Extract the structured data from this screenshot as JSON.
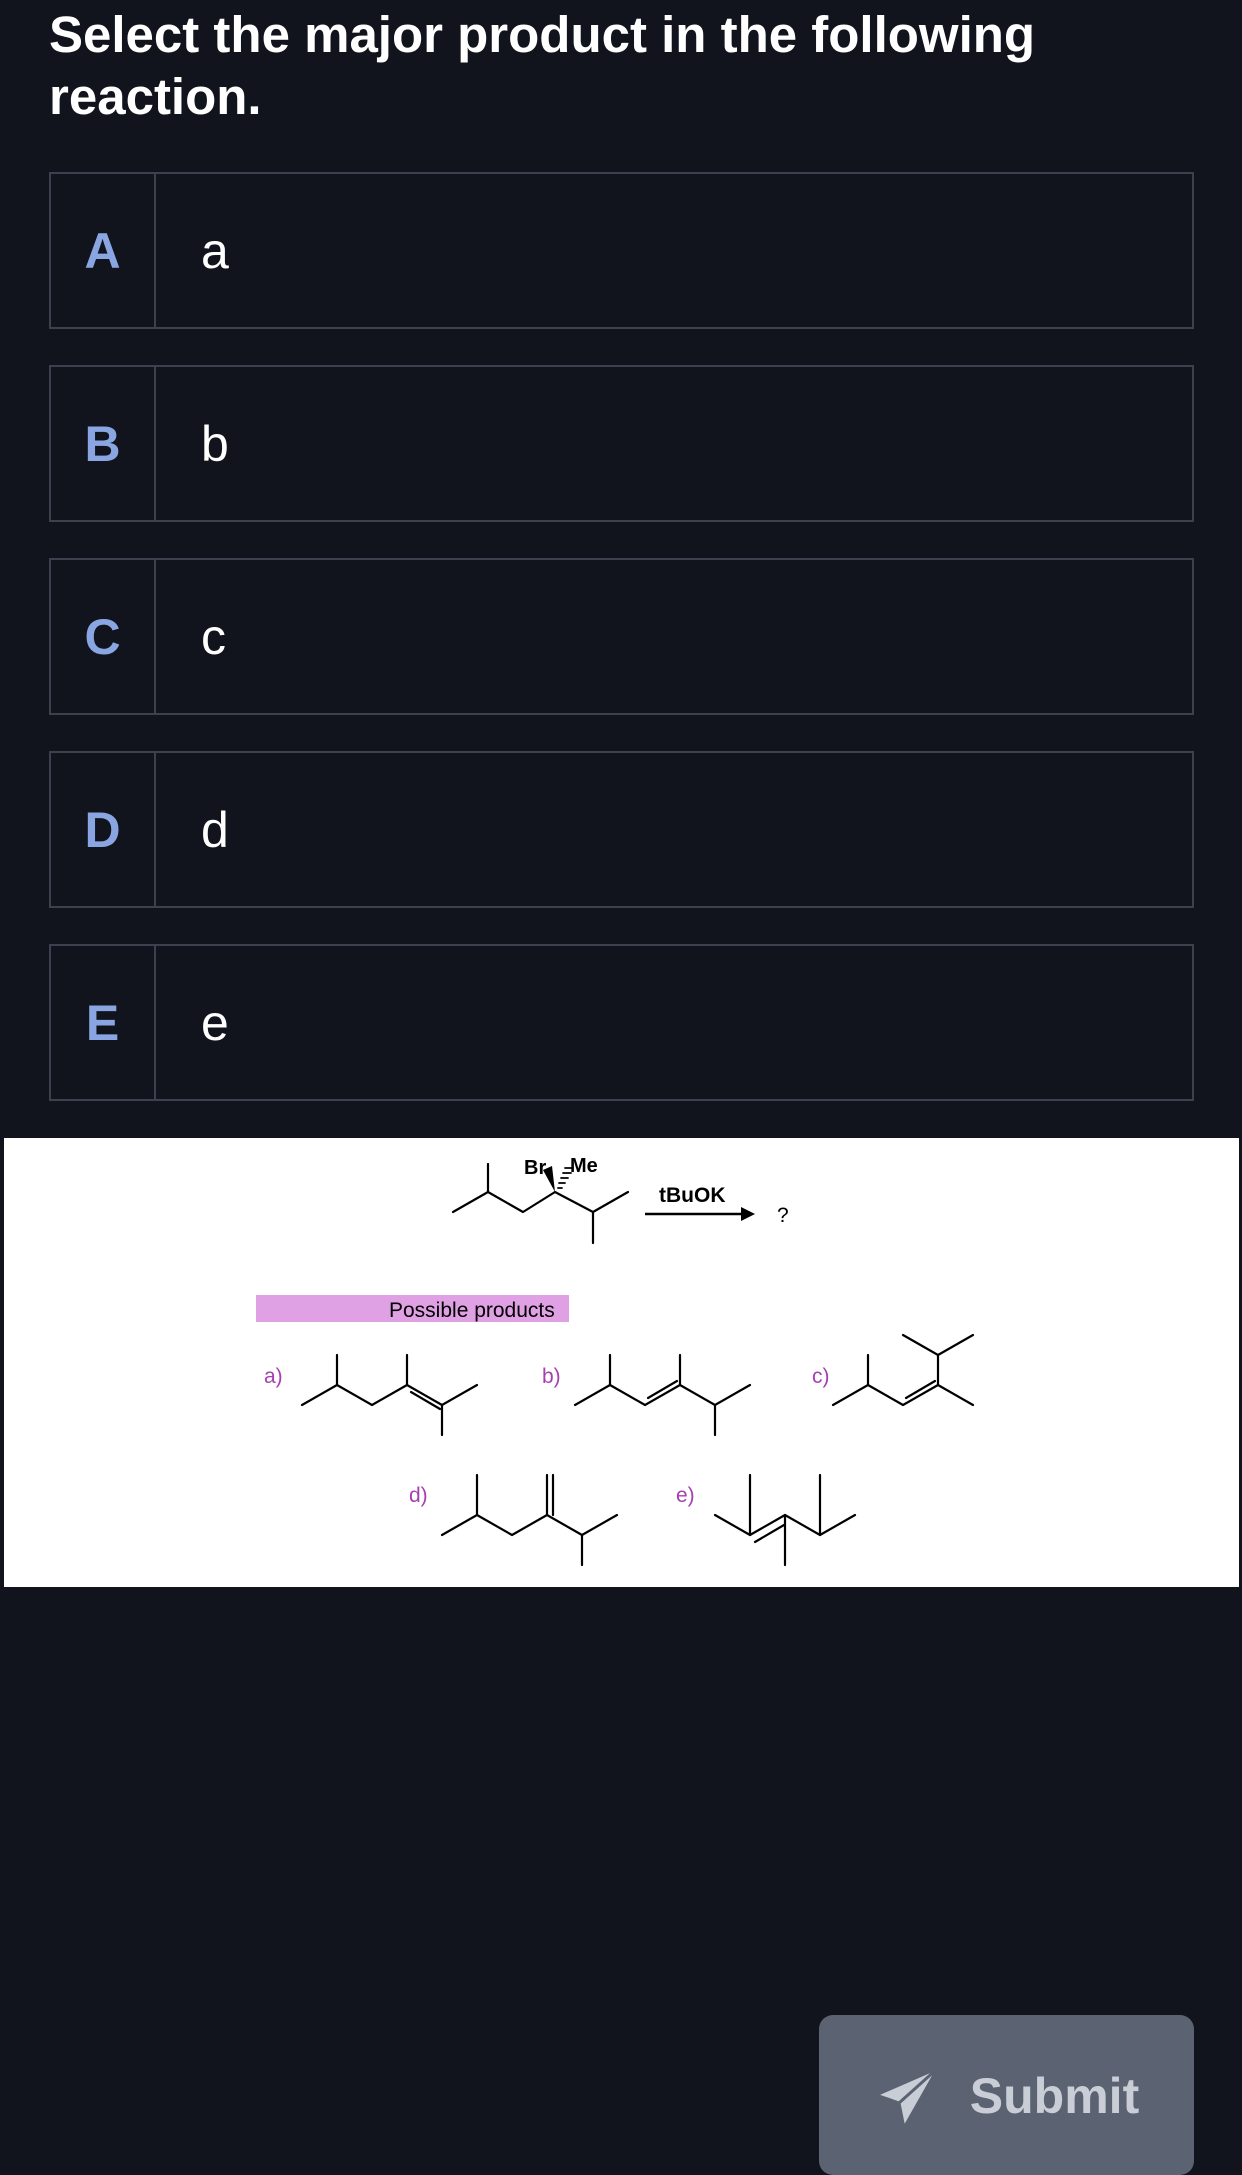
{
  "question": {
    "text": "Select the major product in the following reaction."
  },
  "options": [
    {
      "letter": "A",
      "text": "a"
    },
    {
      "letter": "B",
      "text": "b"
    },
    {
      "letter": "C",
      "text": "c"
    },
    {
      "letter": "D",
      "text": "d"
    },
    {
      "letter": "E",
      "text": "e"
    }
  ],
  "figure": {
    "reactant_labels": {
      "br": "Br",
      "me": "Me"
    },
    "reagent": "tBuOK",
    "product_mark": "?",
    "products_header": "Possible products",
    "product_labels": [
      "a)",
      "b)",
      "c)",
      "d)",
      "e)"
    ],
    "colors": {
      "header_bg": "#e0a0e4",
      "label": "#a540b0"
    }
  },
  "submit": {
    "label": "Submit",
    "icon": "paper-plane-icon"
  },
  "colors": {
    "background": "#11141c",
    "option_border": "#3c4150",
    "option_letter": "#8aa6e2",
    "submit_bg": "#5b6271",
    "submit_text": "#c9cdd6"
  }
}
